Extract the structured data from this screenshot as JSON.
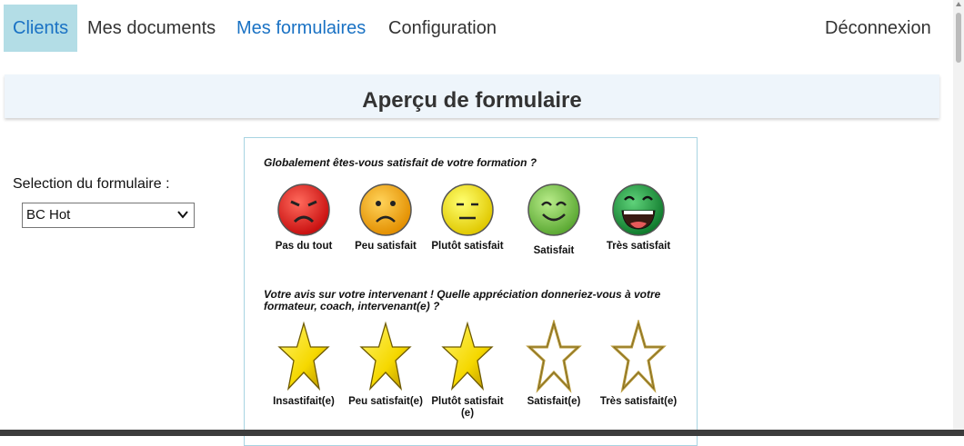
{
  "nav": {
    "items": [
      {
        "label": "Clients"
      },
      {
        "label": "Mes documents"
      },
      {
        "label": "Mes formulaires"
      },
      {
        "label": "Configuration"
      }
    ],
    "logout": "Déconnexion"
  },
  "page_title": "Aperçu de formulaire",
  "selection": {
    "label": "Selection du formulaire :",
    "value": "BC Hot"
  },
  "form": {
    "questions": [
      {
        "text": "Globalement êtes-vous satisfait de votre formation ?",
        "type": "smiley",
        "options": [
          {
            "label": "Pas du tout",
            "icon": "angry-face-icon",
            "color": "#e8261e"
          },
          {
            "label": "Peu satisfait",
            "icon": "sad-face-icon",
            "color": "#f5a800"
          },
          {
            "label": "Plutôt satisfait",
            "icon": "neutral-face-icon",
            "color": "#f5e500"
          },
          {
            "label": "Satisfait",
            "icon": "smile-face-icon",
            "color": "#7cc94a"
          },
          {
            "label": "Très satisfait",
            "icon": "grin-face-icon",
            "color": "#1e9b3c"
          }
        ]
      },
      {
        "text": "Votre avis sur votre intervenant ! Quelle appréciation donneriez-vous à votre formateur, coach, intervenant(e) ?",
        "type": "stars",
        "options": [
          {
            "label": "Insastifait(e)",
            "icon": "star-filled-icon"
          },
          {
            "label": "Peu satisfait(e)",
            "icon": "star-filled-icon"
          },
          {
            "label": "Plutôt satisfait (e)",
            "icon": "star-filled-icon"
          },
          {
            "label": "Satisfait(e)",
            "icon": "star-empty-icon"
          },
          {
            "label": "Très satisfait(e)",
            "icon": "star-empty-icon"
          }
        ]
      }
    ]
  }
}
